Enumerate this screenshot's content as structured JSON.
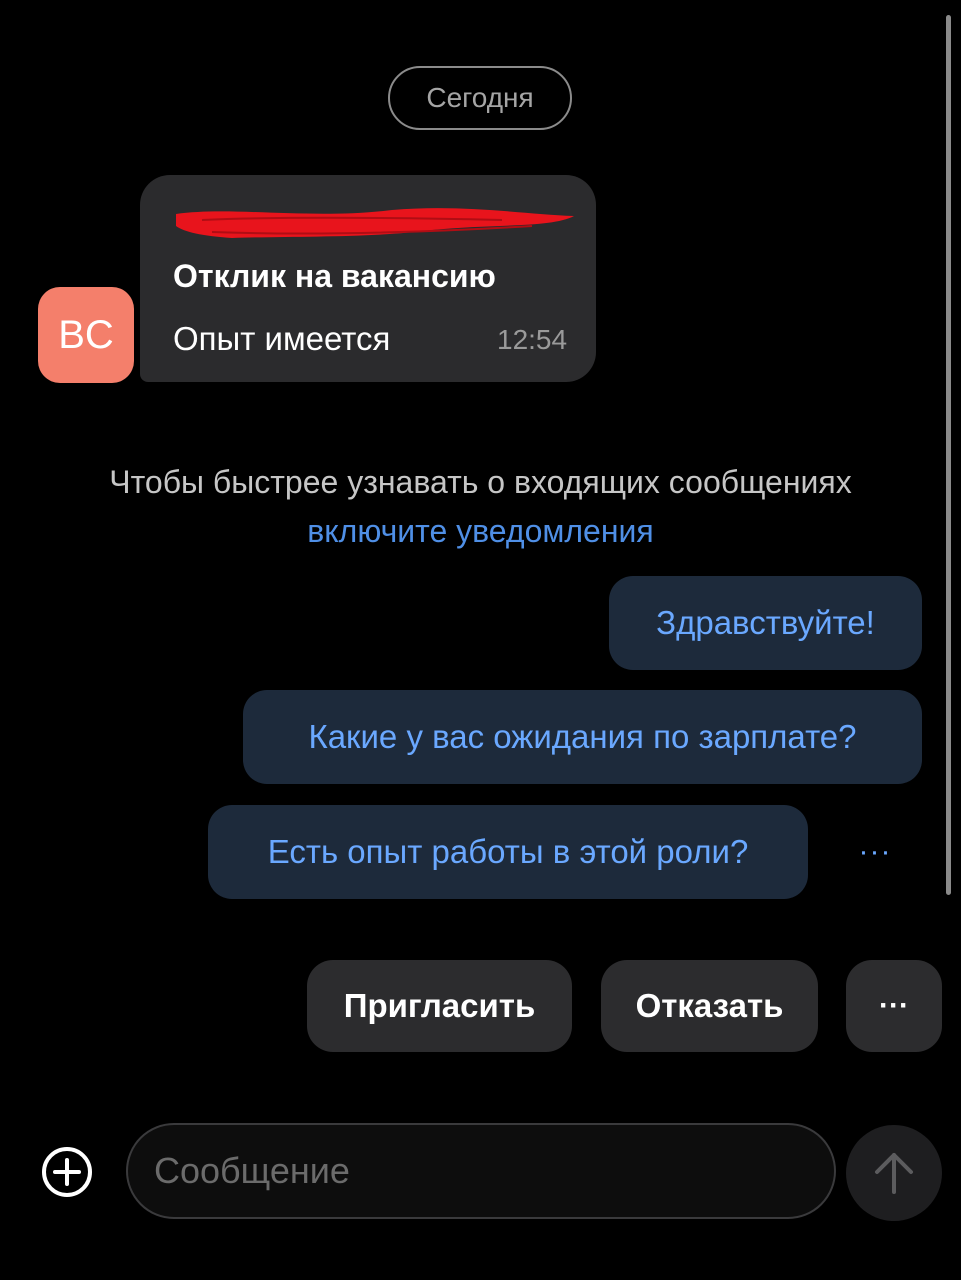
{
  "chat": {
    "date_separator": "Сегодня",
    "incoming": {
      "avatar_initials": "BC",
      "avatar_color": "#f47f6b",
      "title": "Отклик на вакансию",
      "text": "Опыт имеется",
      "time": "12:54"
    },
    "notice": {
      "text": "Чтобы быстрее узнавать о входящих сообщениях",
      "link": "включите уведомления"
    },
    "quick_replies": [
      "Здравствуйте!",
      "Какие у вас ожидания по зарплате?",
      "Есть опыт работы в этой роли?"
    ],
    "quick_more": "···"
  },
  "actions": {
    "invite": "Пригласить",
    "reject": "Отказать",
    "more": "···"
  },
  "composer": {
    "placeholder": "Сообщение"
  },
  "colors": {
    "background": "#000000",
    "bubble": "#2b2b2d",
    "quick_reply_bg": "#1d2a3b",
    "link": "#4f8fe6",
    "redaction": "#e8141c"
  },
  "icons": {
    "add": "plus-circle-icon",
    "send": "arrow-up-icon",
    "more": "ellipsis-icon"
  }
}
